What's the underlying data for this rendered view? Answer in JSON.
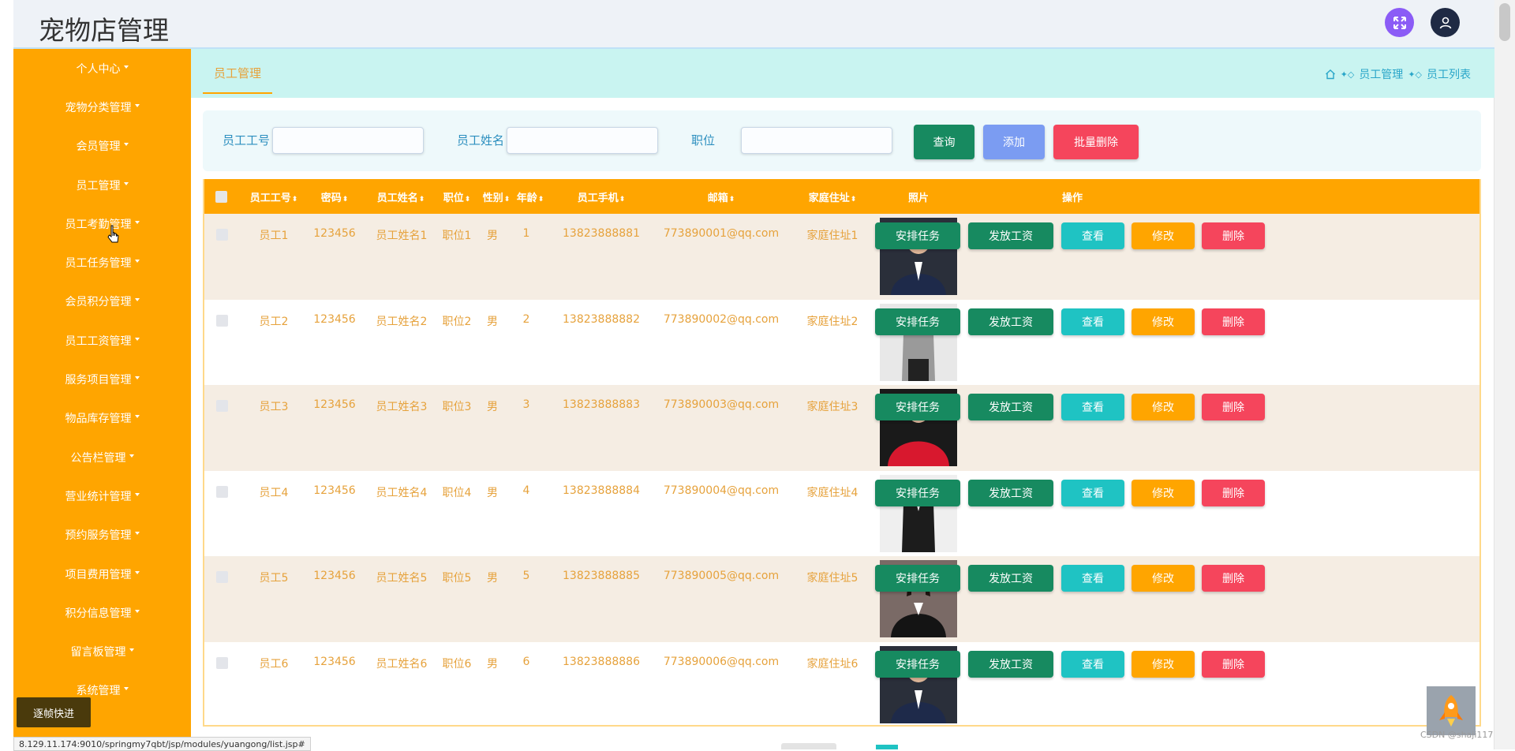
{
  "app_title": "宠物店管理",
  "sidebar": {
    "items": [
      {
        "label": "个人中心"
      },
      {
        "label": "宠物分类管理"
      },
      {
        "label": "会员管理"
      },
      {
        "label": "员工管理"
      },
      {
        "label": "员工考勤管理"
      },
      {
        "label": "员工任务管理"
      },
      {
        "label": "会员积分管理"
      },
      {
        "label": "员工工资管理"
      },
      {
        "label": "服务项目管理"
      },
      {
        "label": "物品库存管理"
      },
      {
        "label": "公告栏管理"
      },
      {
        "label": "营业统计管理"
      },
      {
        "label": "预约服务管理"
      },
      {
        "label": "项目费用管理"
      },
      {
        "label": "积分信息管理"
      },
      {
        "label": "留言板管理"
      },
      {
        "label": "系统管理"
      }
    ]
  },
  "tab": {
    "active": "员工管理"
  },
  "breadcrumb": {
    "level1": "员工管理",
    "level2": "员工列表"
  },
  "search": {
    "label_id": "员工工号",
    "label_name": "员工姓名",
    "label_position": "职位",
    "query": "查询",
    "add": "添加",
    "batch_delete": "批量删除"
  },
  "table": {
    "headers": {
      "emp_id": "员工工号",
      "password": "密码",
      "name": "员工姓名",
      "position": "职位",
      "gender": "性别",
      "age": "年龄",
      "phone": "员工手机",
      "email": "邮箱",
      "address": "家庭住址",
      "photo": "照片",
      "actions": "操作"
    },
    "action_labels": {
      "assign": "安排任务",
      "pay": "发放工资",
      "view": "查看",
      "edit": "修改",
      "delete": "删除"
    },
    "rows": [
      {
        "emp_id": "员工1",
        "password": "123456",
        "name": "员工姓名1",
        "position": "职位1",
        "gender": "男",
        "age": "1",
        "phone": "13823888881",
        "email": "773890001@qq.com",
        "address": "家庭住址1"
      },
      {
        "emp_id": "员工2",
        "password": "123456",
        "name": "员工姓名2",
        "position": "职位2",
        "gender": "男",
        "age": "2",
        "phone": "13823888882",
        "email": "773890002@qq.com",
        "address": "家庭住址2"
      },
      {
        "emp_id": "员工3",
        "password": "123456",
        "name": "员工姓名3",
        "position": "职位3",
        "gender": "男",
        "age": "3",
        "phone": "13823888883",
        "email": "773890003@qq.com",
        "address": "家庭住址3"
      },
      {
        "emp_id": "员工4",
        "password": "123456",
        "name": "员工姓名4",
        "position": "职位4",
        "gender": "男",
        "age": "4",
        "phone": "13823888884",
        "email": "773890004@qq.com",
        "address": "家庭住址4"
      },
      {
        "emp_id": "员工5",
        "password": "123456",
        "name": "员工姓名5",
        "position": "职位5",
        "gender": "男",
        "age": "5",
        "phone": "13823888885",
        "email": "773890005@qq.com",
        "address": "家庭住址5"
      },
      {
        "emp_id": "员工6",
        "password": "123456",
        "name": "员工姓名6",
        "position": "职位6",
        "gender": "男",
        "age": "6",
        "phone": "13823888886",
        "email": "773890006@qq.com",
        "address": "家庭住址6"
      }
    ]
  },
  "speed_button": "逐帧快进",
  "status_url": "8.129.11.174:9010/springmy7qbt/jsp/modules/yuangong/list.jsp#",
  "watermark": "CSDN @shaji117",
  "colors": {
    "sidebar": "#ffa500",
    "header_row": "#ffa500",
    "tab_bar": "#c9f4f1",
    "text_accent": "#e6a23c",
    "btn_green": "#178a60",
    "btn_blue": "#7b9cf2",
    "btn_red": "#f5455c",
    "btn_teal": "#1fc3c3"
  },
  "icons": [
    "fullscreen-icon",
    "user-icon",
    "home-icon",
    "rocket-icon",
    "sort-icon",
    "caret-down-icon",
    "mouse-cursor-icon"
  ]
}
